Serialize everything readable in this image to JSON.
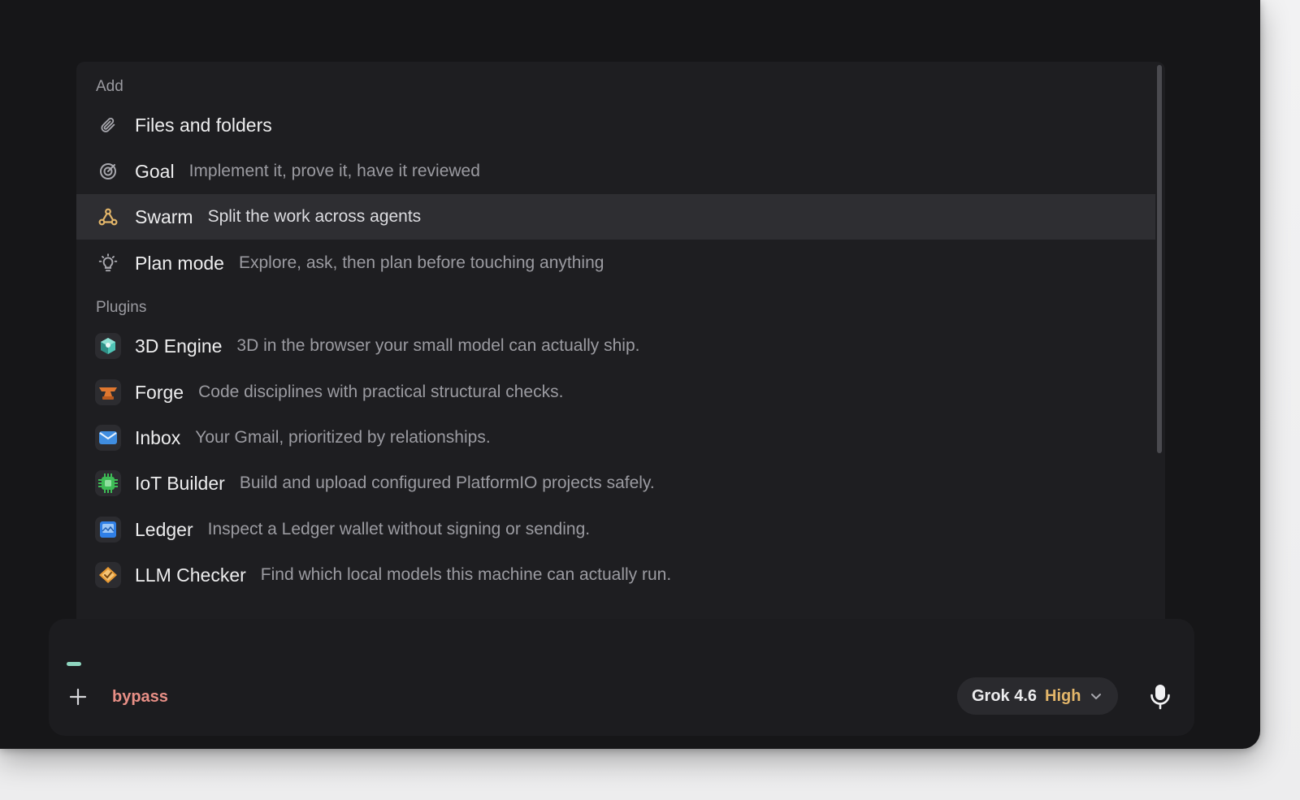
{
  "menu": {
    "add_section_label": "Add",
    "add_items": [
      {
        "title": "Files and folders",
        "desc": "",
        "icon": "paperclip-icon"
      },
      {
        "title": "Goal",
        "desc": "Implement it, prove it, have it reviewed",
        "icon": "target-icon"
      },
      {
        "title": "Swarm",
        "desc": "Split the work across agents",
        "icon": "network-icon",
        "active": true
      },
      {
        "title": "Plan mode",
        "desc": "Explore, ask, then plan before touching anything",
        "icon": "lightbulb-icon"
      }
    ],
    "plugins_section_label": "Plugins",
    "plugins": [
      {
        "title": "3D Engine",
        "desc": "3D in the browser your small model can actually ship.",
        "icon": "cube-icon",
        "color": "#4fc3b5"
      },
      {
        "title": "Forge",
        "desc": "Code disciplines with practical structural checks.",
        "icon": "anvil-icon",
        "color": "#e0772f"
      },
      {
        "title": "Inbox",
        "desc": "Your Gmail, prioritized by relationships.",
        "icon": "envelope-icon",
        "color": "#3f8de0"
      },
      {
        "title": "IoT Builder",
        "desc": "Build and upload configured PlatformIO projects safely.",
        "icon": "chip-icon",
        "color": "#3dbb55"
      },
      {
        "title": "Ledger",
        "desc": "Inspect a Ledger wallet without signing or sending.",
        "icon": "wallet-icon",
        "color": "#2f7fe6"
      },
      {
        "title": "LLM Checker",
        "desc": "Find which local models this machine can actually run.",
        "icon": "checker-icon",
        "color": "#e89a33"
      }
    ]
  },
  "composer": {
    "mode": "bypass",
    "mode_color": "#e88f86",
    "model": "Grok 4.6",
    "effort": "High",
    "effort_color": "#e3b66a",
    "plus_icon": "plus-icon",
    "mic_icon": "microphone-icon"
  }
}
